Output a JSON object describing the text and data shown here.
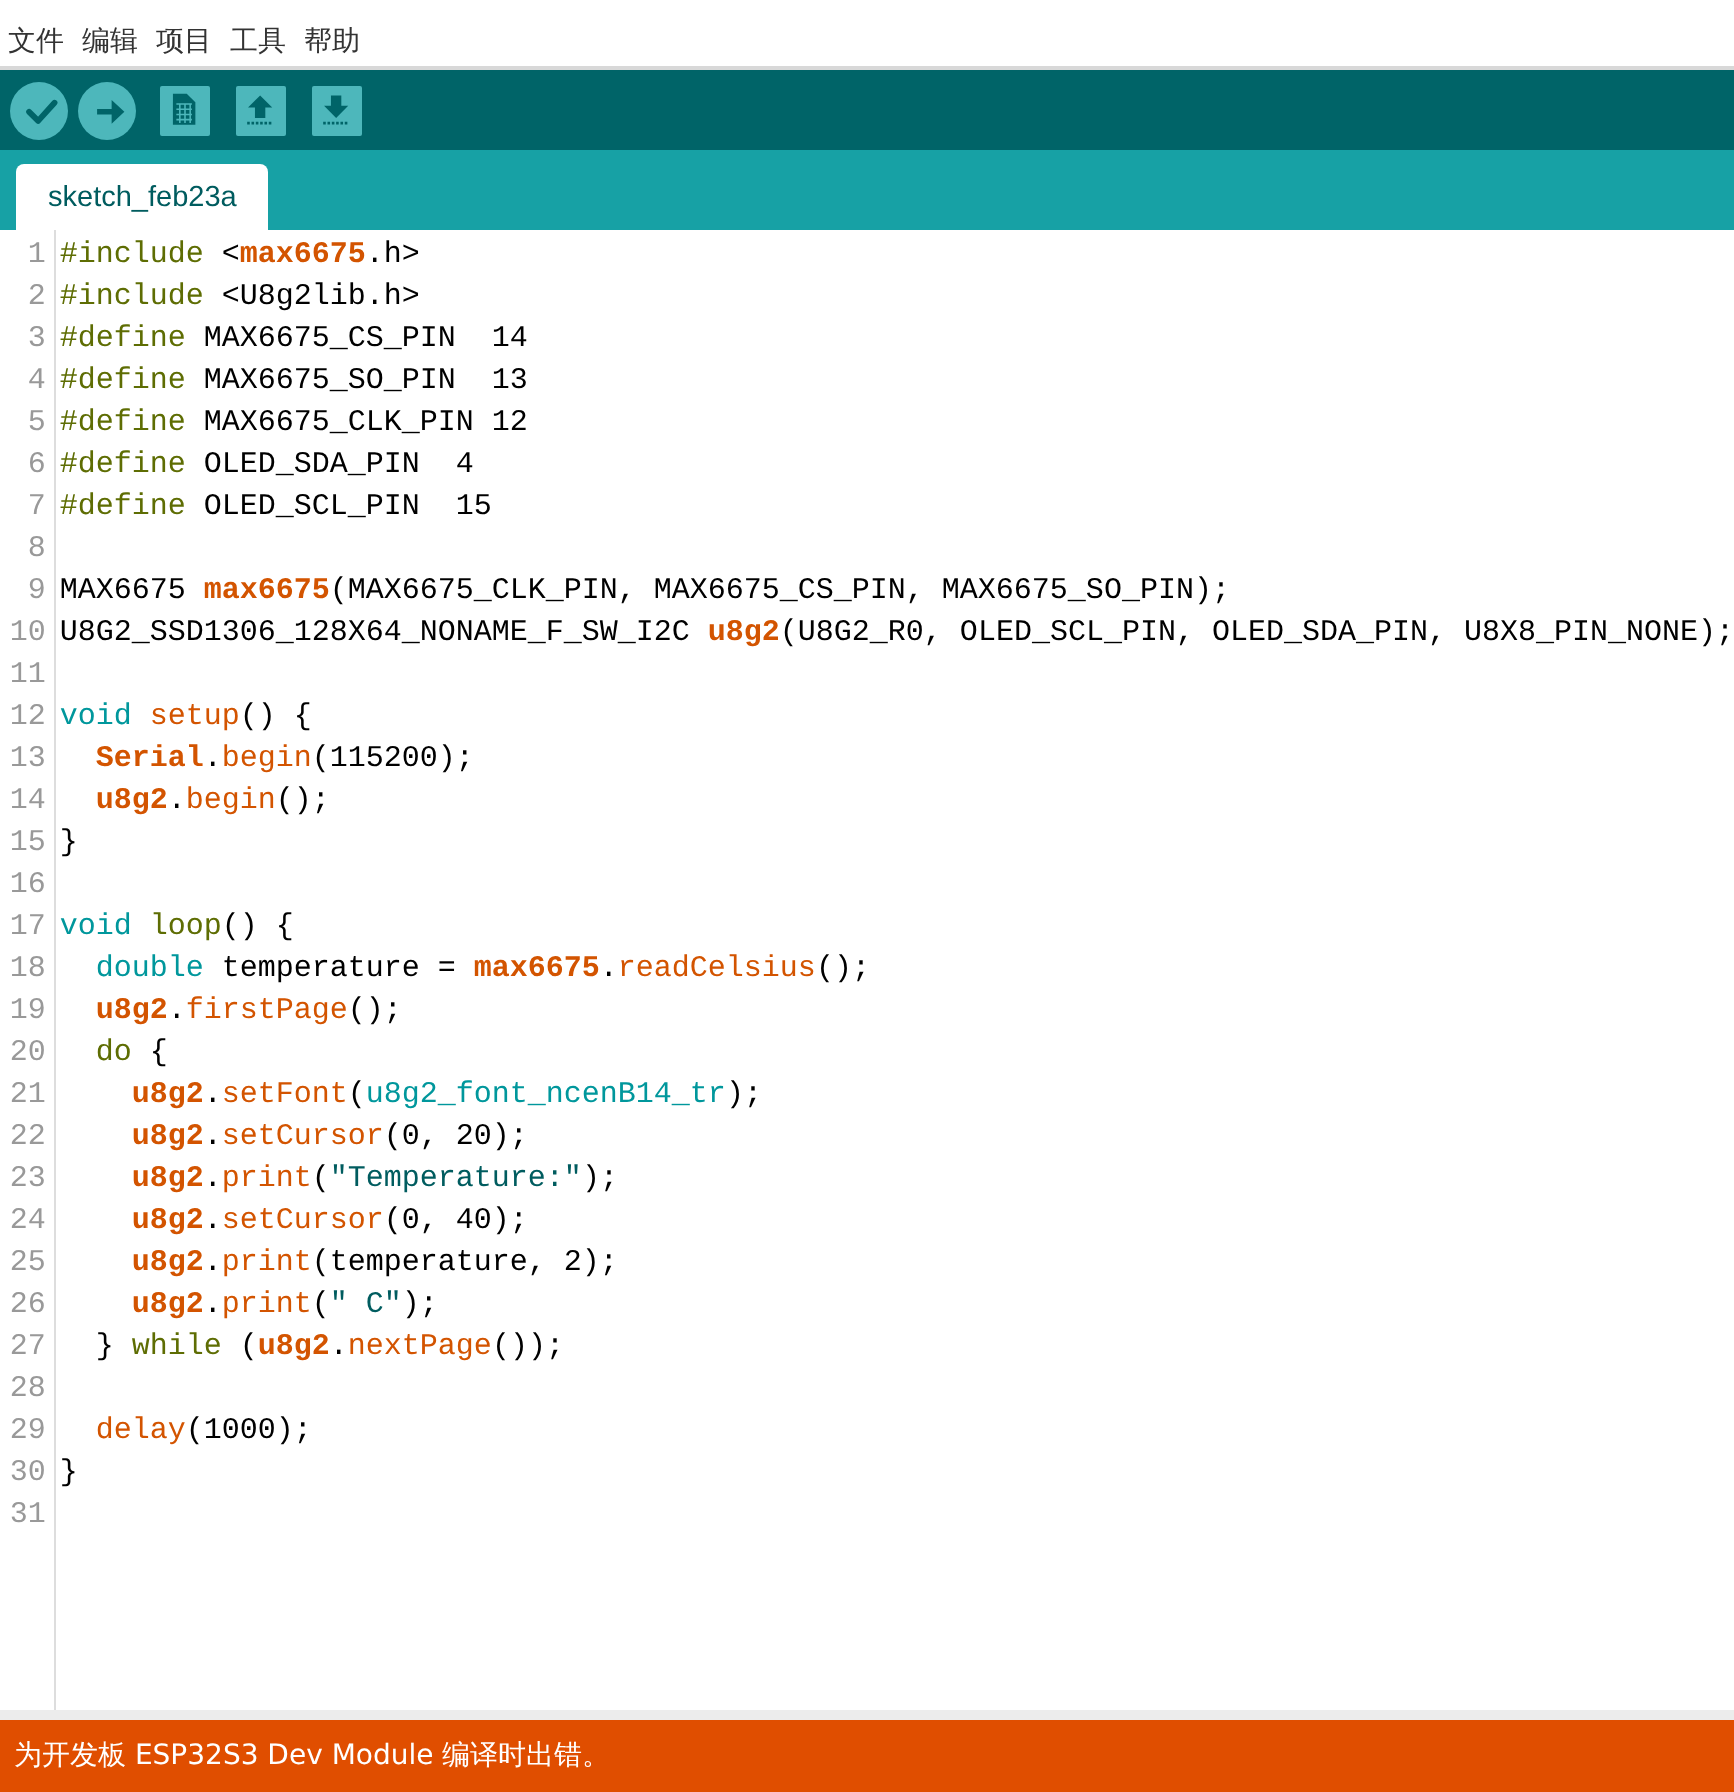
{
  "menu": [
    "文件",
    "编辑",
    "项目",
    "工具",
    "帮助"
  ],
  "toolbar": [
    {
      "kind": "verify"
    },
    {
      "kind": "upload"
    },
    {
      "kind": "new"
    },
    {
      "kind": "open"
    },
    {
      "kind": "save"
    }
  ],
  "tabs": [
    {
      "label": "sketch_feb23a",
      "selected": true
    }
  ],
  "code_lines": [
    {
      "number": "1",
      "tokens": [
        {
          "text": "#include",
          "kind": "directive"
        },
        {
          "text": " <",
          "kind": "plain"
        },
        {
          "text": "max6675",
          "kind": "object"
        },
        {
          "text": ".h>",
          "kind": "plain"
        }
      ]
    },
    {
      "number": "2",
      "tokens": [
        {
          "text": "#include",
          "kind": "directive"
        },
        {
          "text": " <U8g2lib.h>",
          "kind": "plain"
        }
      ]
    },
    {
      "number": "3",
      "tokens": [
        {
          "text": "#define",
          "kind": "directive"
        },
        {
          "text": " MAX6675_CS_PIN  14",
          "kind": "plain"
        }
      ]
    },
    {
      "number": "4",
      "tokens": [
        {
          "text": "#define",
          "kind": "directive"
        },
        {
          "text": " MAX6675_SO_PIN  13",
          "kind": "plain"
        }
      ]
    },
    {
      "number": "5",
      "tokens": [
        {
          "text": "#define",
          "kind": "directive"
        },
        {
          "text": " MAX6675_CLK_PIN 12",
          "kind": "plain"
        }
      ]
    },
    {
      "number": "6",
      "tokens": [
        {
          "text": "#define",
          "kind": "directive"
        },
        {
          "text": " OLED_SDA_PIN  4",
          "kind": "plain"
        }
      ]
    },
    {
      "number": "7",
      "tokens": [
        {
          "text": "#define",
          "kind": "directive"
        },
        {
          "text": " OLED_SCL_PIN  15",
          "kind": "plain"
        }
      ]
    },
    {
      "number": "8"
    },
    {
      "number": "9",
      "tokens": [
        {
          "text": "MAX6675 ",
          "kind": "plain"
        },
        {
          "text": "max6675",
          "kind": "object"
        },
        {
          "text": "(MAX6675_CLK_PIN, MAX6675_CS_PIN, MAX6675_SO_PIN);",
          "kind": "plain"
        }
      ]
    },
    {
      "number": "10",
      "tokens": [
        {
          "text": "U8G2_SSD1306_128X64_NONAME_F_SW_I2C ",
          "kind": "plain"
        },
        {
          "text": "u8g2",
          "kind": "object"
        },
        {
          "text": "(U8G2_R0, OLED_SCL_PIN, OLED_SDA_PIN, U8X8_PIN_NONE);",
          "kind": "plain"
        }
      ]
    },
    {
      "number": "11"
    },
    {
      "number": "12",
      "tokens": [
        {
          "text": "void ",
          "kind": "type"
        },
        {
          "text": "setup",
          "kind": "function"
        },
        {
          "text": "() {",
          "kind": "plain"
        }
      ]
    },
    {
      "number": "13",
      "tokens": [
        {
          "text": "  Serial",
          "kind": "object"
        },
        {
          "text": ".",
          "kind": "plain"
        },
        {
          "text": "begin",
          "kind": "function"
        },
        {
          "text": "(115200);",
          "kind": "plain"
        }
      ]
    },
    {
      "number": "14",
      "tokens": [
        {
          "text": "  u8g2",
          "kind": "object"
        },
        {
          "text": ".",
          "kind": "plain"
        },
        {
          "text": "begin",
          "kind": "function"
        },
        {
          "text": "();",
          "kind": "plain"
        }
      ]
    },
    {
      "number": "15",
      "tokens": [
        {
          "text": "}",
          "kind": "plain"
        }
      ]
    },
    {
      "number": "16"
    },
    {
      "number": "17",
      "tokens": [
        {
          "text": "void ",
          "kind": "type"
        },
        {
          "text": "loop",
          "kind": "directive"
        },
        {
          "text": "() {",
          "kind": "plain"
        }
      ]
    },
    {
      "number": "18",
      "tokens": [
        {
          "text": "  double",
          "kind": "type"
        },
        {
          "text": " temperature = ",
          "kind": "plain"
        },
        {
          "text": "max6675",
          "kind": "object"
        },
        {
          "text": ".",
          "kind": "plain"
        },
        {
          "text": "readCelsius",
          "kind": "function"
        },
        {
          "text": "();",
          "kind": "plain"
        }
      ]
    },
    {
      "number": "19",
      "tokens": [
        {
          "text": "  u8g2",
          "kind": "object"
        },
        {
          "text": ".",
          "kind": "plain"
        },
        {
          "text": "firstPage",
          "kind": "function"
        },
        {
          "text": "();",
          "kind": "plain"
        }
      ]
    },
    {
      "number": "20",
      "tokens": [
        {
          "text": "  do",
          "kind": "directive"
        },
        {
          "text": " {",
          "kind": "plain"
        }
      ]
    },
    {
      "number": "21",
      "tokens": [
        {
          "text": "    u8g2",
          "kind": "object"
        },
        {
          "text": ".",
          "kind": "plain"
        },
        {
          "text": "setFont",
          "kind": "function"
        },
        {
          "text": "(",
          "kind": "plain"
        },
        {
          "text": "u8g2_font_ncenB14_tr",
          "kind": "type"
        },
        {
          "text": ");",
          "kind": "plain"
        }
      ]
    },
    {
      "number": "22",
      "tokens": [
        {
          "text": "    u8g2",
          "kind": "object"
        },
        {
          "text": ".",
          "kind": "plain"
        },
        {
          "text": "setCursor",
          "kind": "function"
        },
        {
          "text": "(0, 20);",
          "kind": "plain"
        }
      ]
    },
    {
      "number": "23",
      "tokens": [
        {
          "text": "    u8g2",
          "kind": "object"
        },
        {
          "text": ".",
          "kind": "plain"
        },
        {
          "text": "print",
          "kind": "function"
        },
        {
          "text": "(",
          "kind": "plain"
        },
        {
          "text": "\"Temperature:\"",
          "kind": "string"
        },
        {
          "text": ");",
          "kind": "plain"
        }
      ]
    },
    {
      "number": "24",
      "tokens": [
        {
          "text": "    u8g2",
          "kind": "object"
        },
        {
          "text": ".",
          "kind": "plain"
        },
        {
          "text": "setCursor",
          "kind": "function"
        },
        {
          "text": "(0, 40);",
          "kind": "plain"
        }
      ]
    },
    {
      "number": "25",
      "tokens": [
        {
          "text": "    u8g2",
          "kind": "object"
        },
        {
          "text": ".",
          "kind": "plain"
        },
        {
          "text": "print",
          "kind": "function"
        },
        {
          "text": "(temperature, 2);",
          "kind": "plain"
        }
      ]
    },
    {
      "number": "26",
      "tokens": [
        {
          "text": "    u8g2",
          "kind": "object"
        },
        {
          "text": ".",
          "kind": "plain"
        },
        {
          "text": "print",
          "kind": "function"
        },
        {
          "text": "(",
          "kind": "plain"
        },
        {
          "text": "\" C\"",
          "kind": "string"
        },
        {
          "text": ");",
          "kind": "plain"
        }
      ]
    },
    {
      "number": "27",
      "tokens": [
        {
          "text": "  } ",
          "kind": "plain"
        },
        {
          "text": "while",
          "kind": "directive"
        },
        {
          "text": " (",
          "kind": "plain"
        },
        {
          "text": "u8g2",
          "kind": "object"
        },
        {
          "text": ".",
          "kind": "plain"
        },
        {
          "text": "nextPage",
          "kind": "function"
        },
        {
          "text": "());",
          "kind": "plain"
        }
      ]
    },
    {
      "number": "28"
    },
    {
      "number": "29",
      "tokens": [
        {
          "text": "  delay",
          "kind": "function"
        },
        {
          "text": "(1000);",
          "kind": "plain"
        }
      ]
    },
    {
      "number": "30",
      "tokens": [
        {
          "text": "}",
          "kind": "plain"
        }
      ]
    },
    {
      "number": "31"
    }
  ],
  "status_bar": {
    "message": "为开发板 ESP32S3 Dev Module 编译时出错。"
  }
}
